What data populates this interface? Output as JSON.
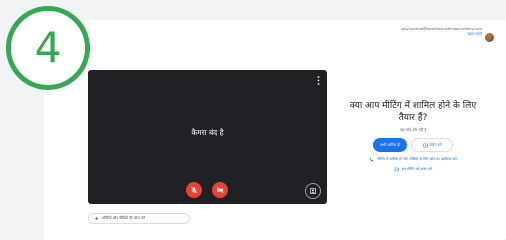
{
  "step": {
    "number": "4",
    "color": "#34a853"
  },
  "account": {
    "email": "ajayhazama@businessmeetingacademy.com",
    "switch_label": "खाता बदलें"
  },
  "preview": {
    "camera_off_text": "कैमरा बंद है",
    "mic_state": "muted",
    "camera_state": "off"
  },
  "check_pill": {
    "label": "ऑडियो और वीडियो की जांच करें"
  },
  "join": {
    "title": "क्या आप मीटिंग में शामिल होने के लिए तैयार हैं?",
    "subtitle": "यहां कोई और नहीं है",
    "join_button": "अभी शामिल हों",
    "present_button": "प्रेज़ेंट करें",
    "options": [
      {
        "label": "मीटिंग में शामिल हों और ऑडियो के लिए फ़ोन का इस्तेमाल करें",
        "icon": "phone-icon"
      },
      {
        "label": "इस मीटिंग को कास्ट करें",
        "icon": "cast-icon"
      }
    ]
  },
  "colors": {
    "accent": "#1a73e8",
    "danger": "#ea4335",
    "preview_bg": "#202124"
  }
}
